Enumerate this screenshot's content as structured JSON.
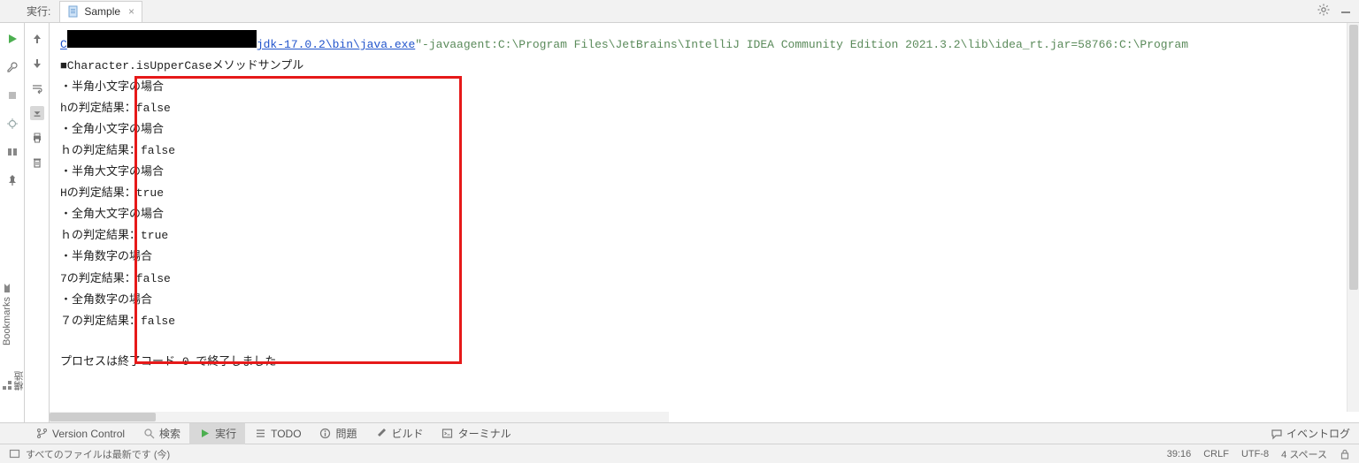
{
  "header": {
    "run_label": "実行:",
    "tab_name": "Sample"
  },
  "cmd": {
    "pre": "C",
    "post": "jdk-17.0.2\\bin\\java.exe",
    "args": " \"-javaagent:C:\\Program Files\\JetBrains\\IntelliJ IDEA Community Edition 2021.3.2\\lib\\idea_rt.jar=58766:C:\\Program"
  },
  "output": [
    "■Character.isUpperCaseメソッドサンプル",
    "・半角小文字の場合",
    "hの判定結果：false",
    "・全角小文字の場合",
    "ｈの判定結果：false",
    "・半角大文字の場合",
    "Hの判定結果：true",
    "・全角大文字の場合",
    "ｈの判定結果：true",
    "・半角数字の場合",
    "7の判定結果：false",
    "・全角数字の場合",
    "７の判定結果：false"
  ],
  "exit": {
    "prefix": "プロセスは終了コード ",
    "code": "0",
    "suffix": " で終了しました"
  },
  "bottom_tabs": {
    "version_control": "Version Control",
    "search": "検索",
    "run": "実行",
    "todo": "TODO",
    "problems": "問題",
    "build": "ビルド",
    "terminal": "ターミナル",
    "event_log": "イベントログ"
  },
  "status": {
    "msg": "すべてのファイルは最新です (今)",
    "pos": "39:16",
    "line_sep": "CRLF",
    "encoding": "UTF-8",
    "indent": "4 スペース"
  },
  "side": {
    "bookmarks": "Bookmarks",
    "structure": "構造"
  }
}
